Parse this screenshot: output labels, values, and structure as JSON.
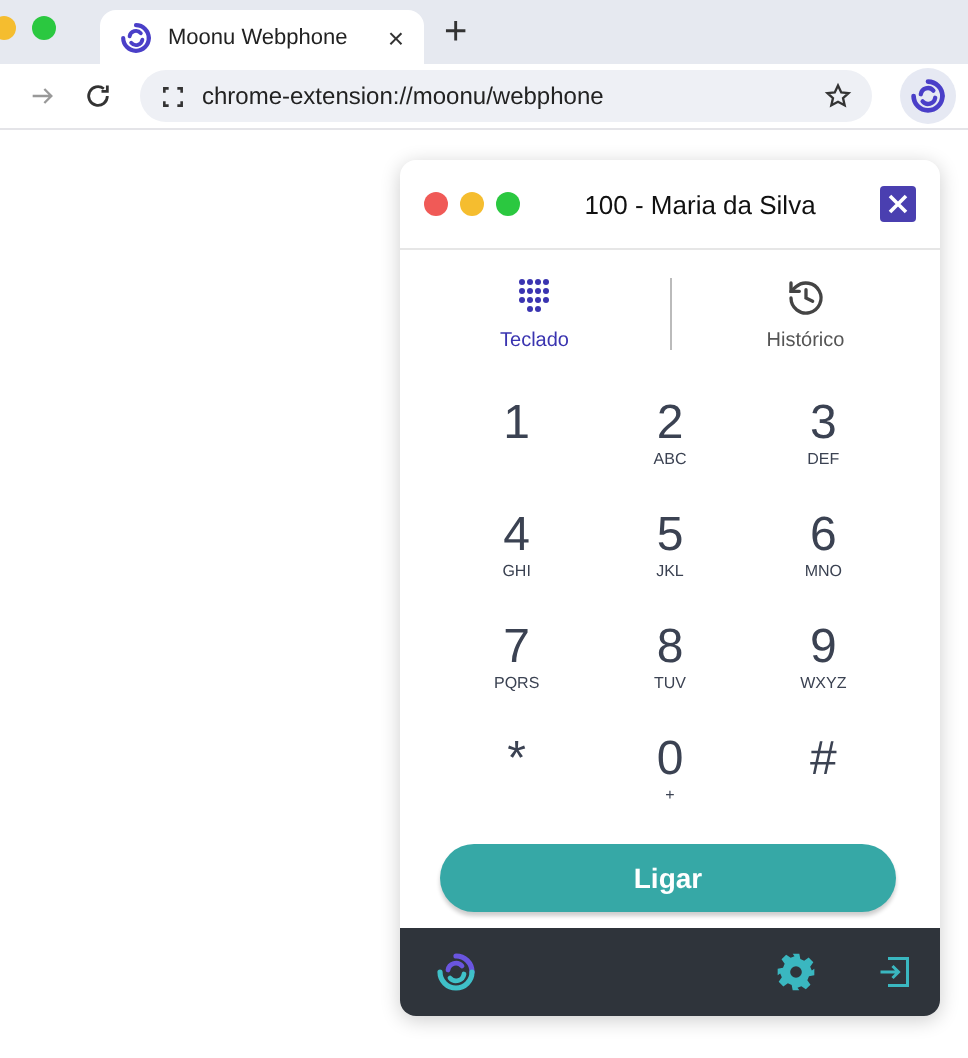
{
  "browser": {
    "tab": {
      "title": "Moonu Webphone",
      "close": "×"
    },
    "new_tab": "+",
    "address": "chrome-extension://moonu/webphone"
  },
  "phone": {
    "title": "100 - Maria da Silva",
    "tabs": [
      {
        "label": "Teclado",
        "kind": "keypad",
        "selected": true
      },
      {
        "label": "Histórico",
        "kind": "history",
        "selected": false
      }
    ],
    "keys": [
      {
        "digit": "1"
      },
      {
        "digit": "2",
        "letters": "ABC"
      },
      {
        "digit": "3",
        "letters": "DEF"
      },
      {
        "digit": "4",
        "letters": "GHI"
      },
      {
        "digit": "5",
        "letters": "JKL"
      },
      {
        "digit": "6",
        "letters": "MNO"
      },
      {
        "digit": "7",
        "letters": "PQRS"
      },
      {
        "digit": "8",
        "letters": "TUV"
      },
      {
        "digit": "9",
        "letters": "WXYZ"
      },
      {
        "digit": "*"
      },
      {
        "digit": "0",
        "letters": "+"
      },
      {
        "digit": "#"
      }
    ],
    "call_button": "Ligar"
  }
}
